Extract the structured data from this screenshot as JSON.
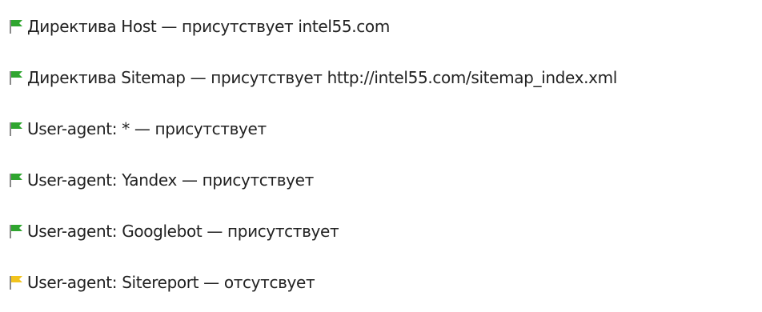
{
  "colors": {
    "present": "#2fa52f",
    "absent": "#f2c31d",
    "text": "#222222"
  },
  "checks": [
    {
      "status": "present",
      "icon": "green-flag-icon",
      "text": "Директива Host — присутствует intel55.com"
    },
    {
      "status": "present",
      "icon": "green-flag-icon",
      "text": "Директива Sitemap — присутствует http://intel55.com/sitemap_index.xml"
    },
    {
      "status": "present",
      "icon": "green-flag-icon",
      "text": "User-agent: * — присутствует"
    },
    {
      "status": "present",
      "icon": "green-flag-icon",
      "text": "User-agent: Yandex — присутствует"
    },
    {
      "status": "present",
      "icon": "green-flag-icon",
      "text": "User-agent: Googlebot — присутствует"
    },
    {
      "status": "absent",
      "icon": "yellow-flag-icon",
      "text": "User-agent: Sitereport — отсутсвует"
    }
  ]
}
